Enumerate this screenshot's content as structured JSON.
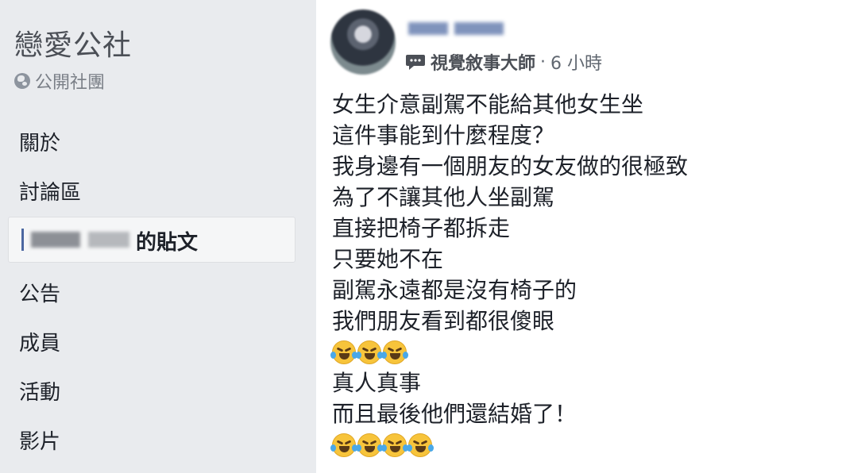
{
  "sidebar": {
    "group_name": "戀愛公社",
    "privacy": "公開社團",
    "items": [
      {
        "label": "關於"
      },
      {
        "label": "討論區"
      },
      {
        "label": "的貼文",
        "active": true
      },
      {
        "label": "公告"
      },
      {
        "label": "成員"
      },
      {
        "label": "活動"
      },
      {
        "label": "影片"
      }
    ]
  },
  "post": {
    "via": "視覺敘事大師",
    "separator": "·",
    "time": "6 小時",
    "lines": [
      "女生介意副駕不能給其他女生坐",
      "這件事能到什麼程度？",
      "我身邊有一個朋友的女友做的很極致",
      "為了不讓其他人坐副駕",
      "直接把椅子都拆走",
      "只要她不在",
      "副駕永遠都是沒有椅子的",
      "我們朋友看到都很傻眼",
      "真人真事",
      "而且最後他們還結婚了！"
    ],
    "emoji_row_1_count": 3,
    "emoji_row_2_count": 4,
    "emoji_name": "face-with-tears-of-joy"
  },
  "colors": {
    "sidebar_bg": "#e9ebee",
    "post_bg": "#ffffff",
    "text": "#1d2129",
    "accent": "#4b67a1"
  }
}
